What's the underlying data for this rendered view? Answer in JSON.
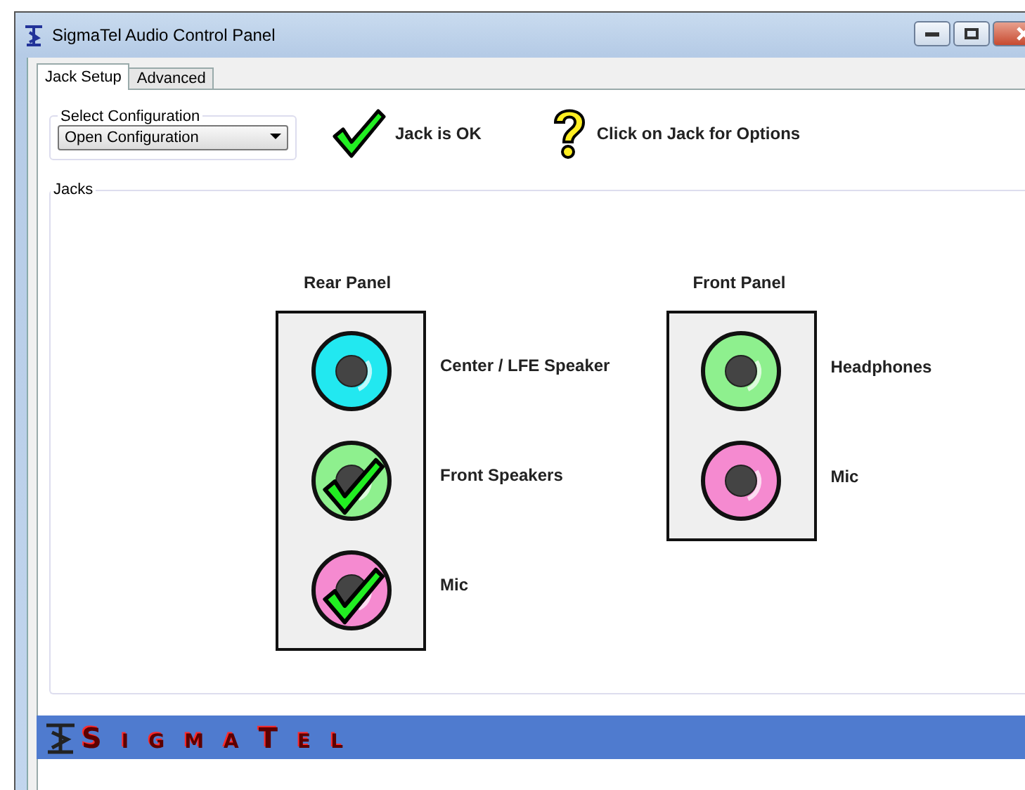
{
  "window": {
    "title": "SigmaTel Audio Control Panel"
  },
  "tabs": [
    {
      "label": "Jack Setup",
      "selected": true
    },
    {
      "label": "Advanced",
      "selected": false
    }
  ],
  "configuration": {
    "label": "Select Configuration",
    "value": "Open Configuration"
  },
  "legend": [
    {
      "kind": "ok",
      "label": "Jack is OK"
    },
    {
      "kind": "help",
      "label": "Click on Jack for Options"
    }
  ],
  "jacks_group": {
    "label": "Jacks"
  },
  "panels": [
    {
      "title": "Rear Panel",
      "jacks": [
        {
          "label": "Center / LFE Speaker",
          "color": "#22e8f0",
          "checked": false
        },
        {
          "label": "Front Speakers",
          "color": "#8ef08e",
          "checked": true
        },
        {
          "label": "Mic",
          "color": "#f58ad0",
          "checked": true
        }
      ]
    },
    {
      "title": "Front Panel",
      "jacks": [
        {
          "label": "Headphones",
          "color": "#8ef08e",
          "checked": false
        },
        {
          "label": "Mic",
          "color": "#f58ad0",
          "checked": false
        }
      ]
    }
  ],
  "brand": {
    "logo": "SigmaTel"
  }
}
